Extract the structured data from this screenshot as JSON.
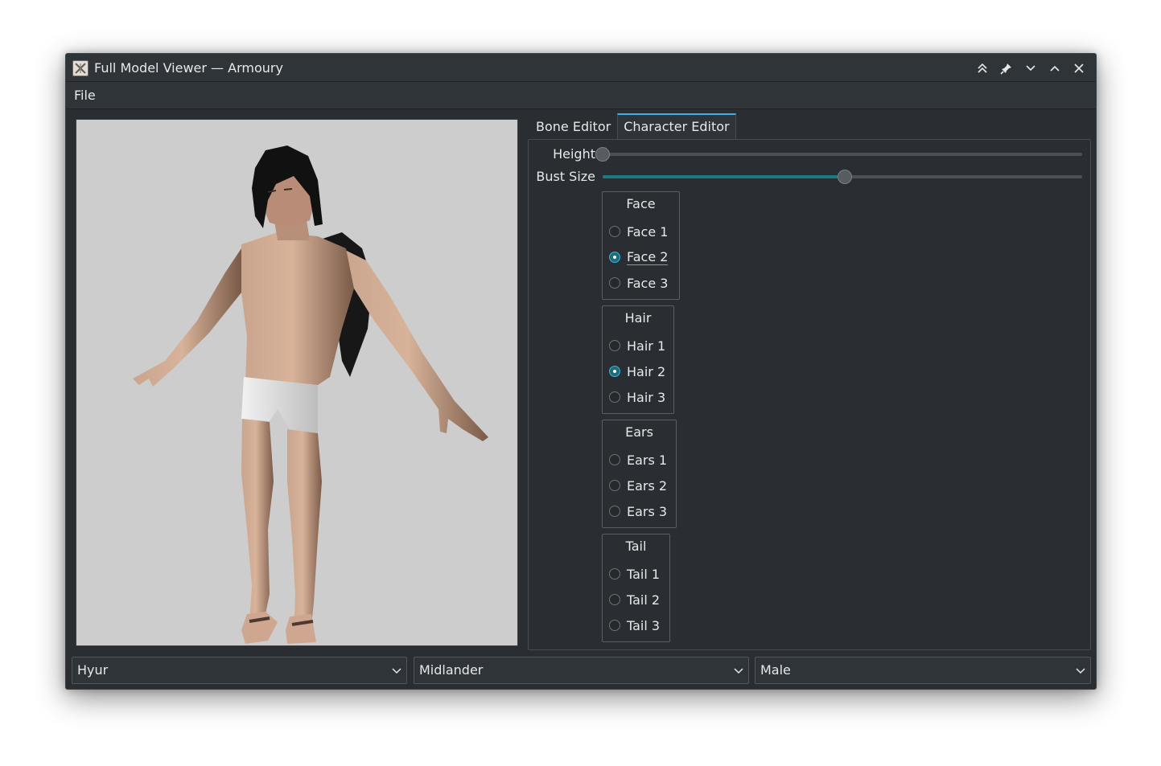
{
  "window": {
    "title": "Full Model Viewer — Armoury"
  },
  "menubar": {
    "file": "File"
  },
  "tabs": [
    {
      "label": "Bone Editor",
      "active": false
    },
    {
      "label": "Character Editor",
      "active": true
    }
  ],
  "sliders": {
    "height": {
      "label": "Height",
      "value": 0.0
    },
    "bust_size": {
      "label": "Bust Size",
      "value": 0.505
    }
  },
  "groups": {
    "face": {
      "title": "Face",
      "options": [
        "Face 1",
        "Face 2",
        "Face 3"
      ],
      "selected": 1
    },
    "hair": {
      "title": "Hair",
      "options": [
        "Hair 1",
        "Hair 2",
        "Hair 3"
      ],
      "selected": 1
    },
    "ears": {
      "title": "Ears",
      "options": [
        "Ears 1",
        "Ears 2",
        "Ears 3"
      ],
      "selected": -1
    },
    "tail": {
      "title": "Tail",
      "options": [
        "Tail 1",
        "Tail 2",
        "Tail 3"
      ],
      "selected": -1
    }
  },
  "combos": {
    "race": "Hyur",
    "subrace": "Midlander",
    "gender": "Male"
  },
  "colors": {
    "accent": "#3daee9",
    "slider_fill": "#1d7a7f",
    "window_bg": "#2a2e32",
    "viewport_bg": "#cdcdcd"
  }
}
